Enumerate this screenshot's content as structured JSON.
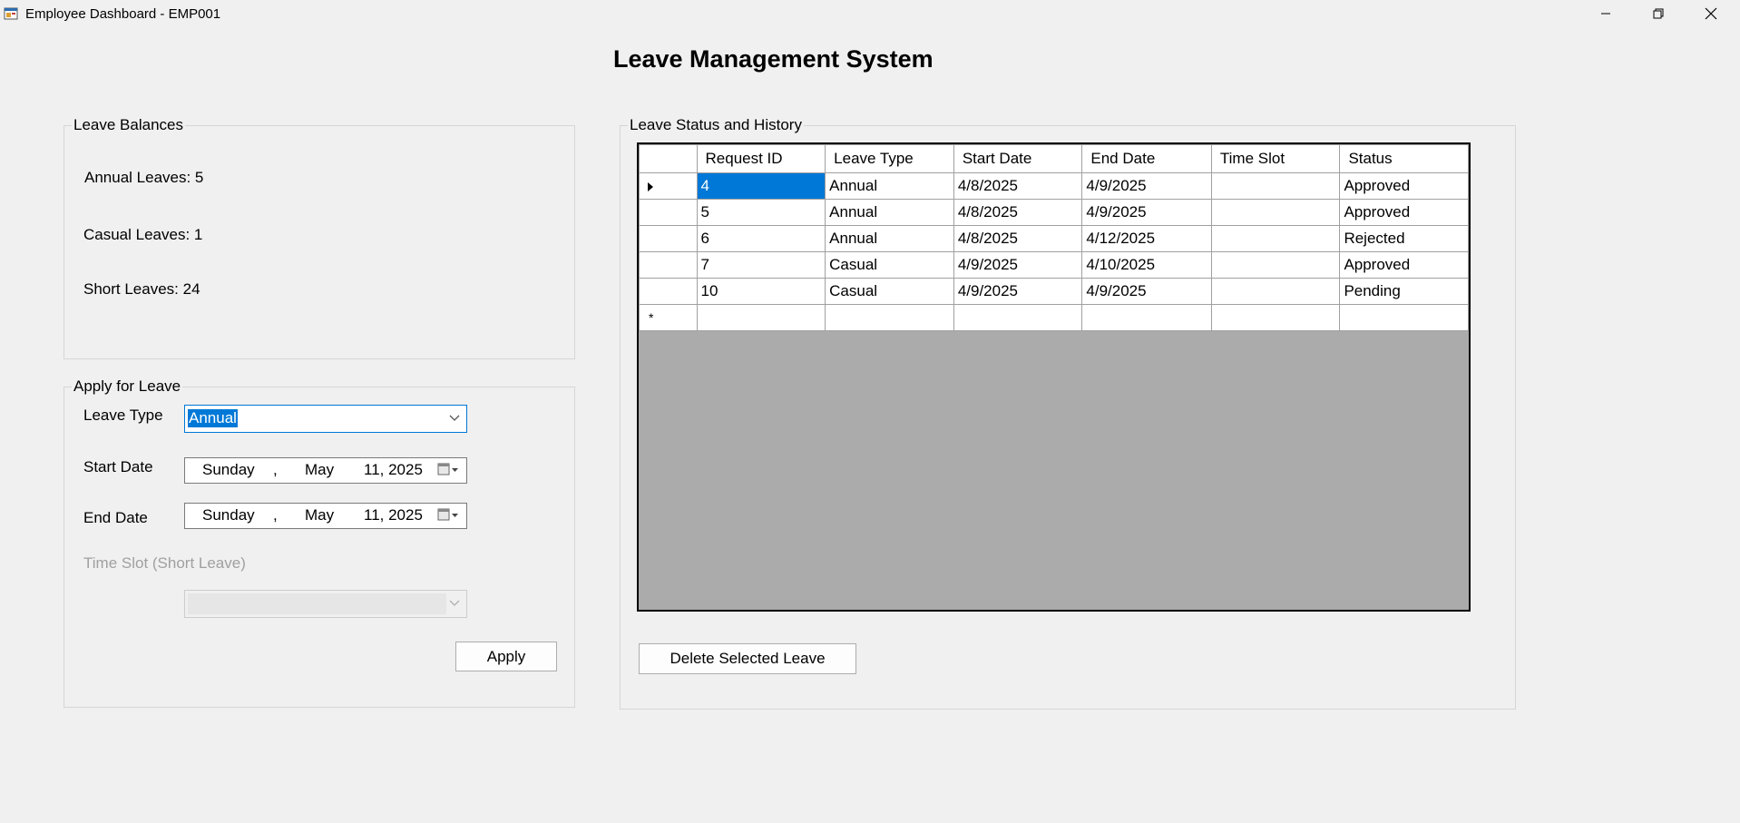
{
  "window": {
    "title": "Employee Dashboard - EMP001",
    "icon": "app-form-icon",
    "controls": [
      "minimize-icon",
      "restore-icon",
      "close-icon"
    ]
  },
  "page": {
    "title": "Leave Management System"
  },
  "balances": {
    "legend": "Leave Balances",
    "annual": "Annual Leaves: 5",
    "casual": "Casual Leaves: 1",
    "short": "Short Leaves: 24"
  },
  "apply": {
    "legend": "Apply for Leave",
    "leave_type_label": "Leave Type",
    "leave_type_value": "Annual",
    "start_label": "Start Date",
    "start_date": {
      "weekday": "Sunday",
      "sep": ",",
      "month": "May",
      "day_year": "11, 2025"
    },
    "end_label": "End Date",
    "end_date": {
      "weekday": "Sunday",
      "sep": ",",
      "month": "May",
      "day_year": "11, 2025"
    },
    "time_slot_label": "Time Slot (Short Leave)",
    "time_slot_value": "",
    "apply_button": "Apply"
  },
  "history": {
    "legend": "Leave Status and History",
    "columns": [
      "Request ID",
      "Leave Type",
      "Start Date",
      "End Date",
      "Time Slot",
      "Status"
    ],
    "rows": [
      [
        "4",
        "Annual",
        "4/8/2025",
        "4/9/2025",
        "",
        "Approved"
      ],
      [
        "5",
        "Annual",
        "4/8/2025",
        "4/9/2025",
        "",
        "Approved"
      ],
      [
        "6",
        "Annual",
        "4/8/2025",
        "4/12/2025",
        "",
        "Rejected"
      ],
      [
        "7",
        "Casual",
        "4/9/2025",
        "4/10/2025",
        "",
        "Approved"
      ],
      [
        "10",
        "Casual",
        "4/9/2025",
        "4/9/2025",
        "",
        "Pending"
      ]
    ],
    "new_row_marker": "*",
    "delete_button": "Delete Selected Leave"
  },
  "colors": {
    "selection": "#0078d7",
    "background": "#f0f0f0",
    "grid_empty": "#ababab"
  }
}
